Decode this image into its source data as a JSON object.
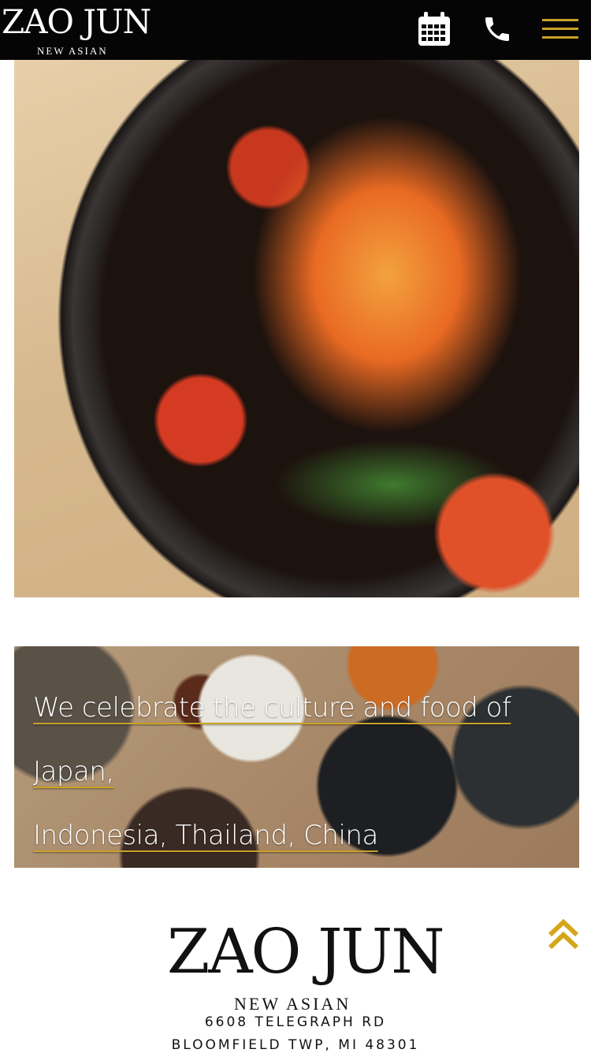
{
  "header": {
    "logo_name": "ZAO JUN",
    "logo_sub": "NEW ASIAN",
    "icons": [
      "calendar-icon",
      "phone-icon",
      "hamburger-menu-icon"
    ],
    "accent_color": "#c9a227"
  },
  "banner": {
    "tagline_line1": "We celebrate the culture and food of",
    "tagline_line2": "Japan,",
    "tagline_line3": "Indonesia, Thailand, China"
  },
  "footer": {
    "logo_name": "ZAO JUN",
    "logo_sub": "NEW ASIAN",
    "address_line1": "6608 TELEGRAPH RD",
    "address_line2": "BLOOMFIELD TWP, MI 48301",
    "back_to_top_icon": "double-chevron-up-icon"
  }
}
